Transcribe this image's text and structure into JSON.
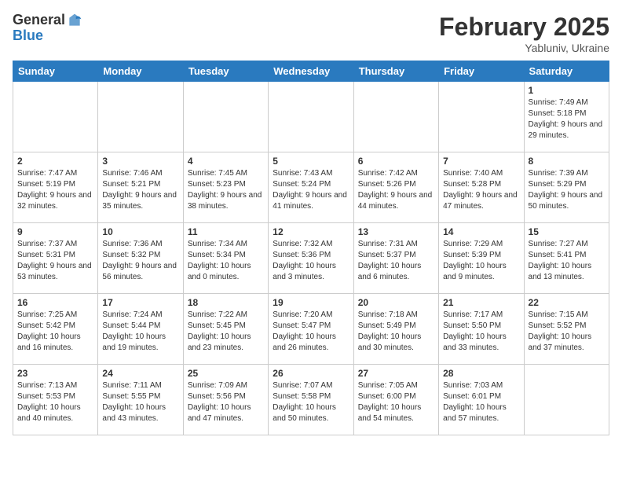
{
  "logo": {
    "general": "General",
    "blue": "Blue"
  },
  "header": {
    "month": "February 2025",
    "location": "Yabluniv, Ukraine"
  },
  "weekdays": [
    "Sunday",
    "Monday",
    "Tuesday",
    "Wednesday",
    "Thursday",
    "Friday",
    "Saturday"
  ],
  "weeks": [
    [
      {
        "day": "",
        "info": ""
      },
      {
        "day": "",
        "info": ""
      },
      {
        "day": "",
        "info": ""
      },
      {
        "day": "",
        "info": ""
      },
      {
        "day": "",
        "info": ""
      },
      {
        "day": "",
        "info": ""
      },
      {
        "day": "1",
        "info": "Sunrise: 7:49 AM\nSunset: 5:18 PM\nDaylight: 9 hours and 29 minutes."
      }
    ],
    [
      {
        "day": "2",
        "info": "Sunrise: 7:47 AM\nSunset: 5:19 PM\nDaylight: 9 hours and 32 minutes."
      },
      {
        "day": "3",
        "info": "Sunrise: 7:46 AM\nSunset: 5:21 PM\nDaylight: 9 hours and 35 minutes."
      },
      {
        "day": "4",
        "info": "Sunrise: 7:45 AM\nSunset: 5:23 PM\nDaylight: 9 hours and 38 minutes."
      },
      {
        "day": "5",
        "info": "Sunrise: 7:43 AM\nSunset: 5:24 PM\nDaylight: 9 hours and 41 minutes."
      },
      {
        "day": "6",
        "info": "Sunrise: 7:42 AM\nSunset: 5:26 PM\nDaylight: 9 hours and 44 minutes."
      },
      {
        "day": "7",
        "info": "Sunrise: 7:40 AM\nSunset: 5:28 PM\nDaylight: 9 hours and 47 minutes."
      },
      {
        "day": "8",
        "info": "Sunrise: 7:39 AM\nSunset: 5:29 PM\nDaylight: 9 hours and 50 minutes."
      }
    ],
    [
      {
        "day": "9",
        "info": "Sunrise: 7:37 AM\nSunset: 5:31 PM\nDaylight: 9 hours and 53 minutes."
      },
      {
        "day": "10",
        "info": "Sunrise: 7:36 AM\nSunset: 5:32 PM\nDaylight: 9 hours and 56 minutes."
      },
      {
        "day": "11",
        "info": "Sunrise: 7:34 AM\nSunset: 5:34 PM\nDaylight: 10 hours and 0 minutes."
      },
      {
        "day": "12",
        "info": "Sunrise: 7:32 AM\nSunset: 5:36 PM\nDaylight: 10 hours and 3 minutes."
      },
      {
        "day": "13",
        "info": "Sunrise: 7:31 AM\nSunset: 5:37 PM\nDaylight: 10 hours and 6 minutes."
      },
      {
        "day": "14",
        "info": "Sunrise: 7:29 AM\nSunset: 5:39 PM\nDaylight: 10 hours and 9 minutes."
      },
      {
        "day": "15",
        "info": "Sunrise: 7:27 AM\nSunset: 5:41 PM\nDaylight: 10 hours and 13 minutes."
      }
    ],
    [
      {
        "day": "16",
        "info": "Sunrise: 7:25 AM\nSunset: 5:42 PM\nDaylight: 10 hours and 16 minutes."
      },
      {
        "day": "17",
        "info": "Sunrise: 7:24 AM\nSunset: 5:44 PM\nDaylight: 10 hours and 19 minutes."
      },
      {
        "day": "18",
        "info": "Sunrise: 7:22 AM\nSunset: 5:45 PM\nDaylight: 10 hours and 23 minutes."
      },
      {
        "day": "19",
        "info": "Sunrise: 7:20 AM\nSunset: 5:47 PM\nDaylight: 10 hours and 26 minutes."
      },
      {
        "day": "20",
        "info": "Sunrise: 7:18 AM\nSunset: 5:49 PM\nDaylight: 10 hours and 30 minutes."
      },
      {
        "day": "21",
        "info": "Sunrise: 7:17 AM\nSunset: 5:50 PM\nDaylight: 10 hours and 33 minutes."
      },
      {
        "day": "22",
        "info": "Sunrise: 7:15 AM\nSunset: 5:52 PM\nDaylight: 10 hours and 37 minutes."
      }
    ],
    [
      {
        "day": "23",
        "info": "Sunrise: 7:13 AM\nSunset: 5:53 PM\nDaylight: 10 hours and 40 minutes."
      },
      {
        "day": "24",
        "info": "Sunrise: 7:11 AM\nSunset: 5:55 PM\nDaylight: 10 hours and 43 minutes."
      },
      {
        "day": "25",
        "info": "Sunrise: 7:09 AM\nSunset: 5:56 PM\nDaylight: 10 hours and 47 minutes."
      },
      {
        "day": "26",
        "info": "Sunrise: 7:07 AM\nSunset: 5:58 PM\nDaylight: 10 hours and 50 minutes."
      },
      {
        "day": "27",
        "info": "Sunrise: 7:05 AM\nSunset: 6:00 PM\nDaylight: 10 hours and 54 minutes."
      },
      {
        "day": "28",
        "info": "Sunrise: 7:03 AM\nSunset: 6:01 PM\nDaylight: 10 hours and 57 minutes."
      },
      {
        "day": "",
        "info": ""
      }
    ]
  ]
}
